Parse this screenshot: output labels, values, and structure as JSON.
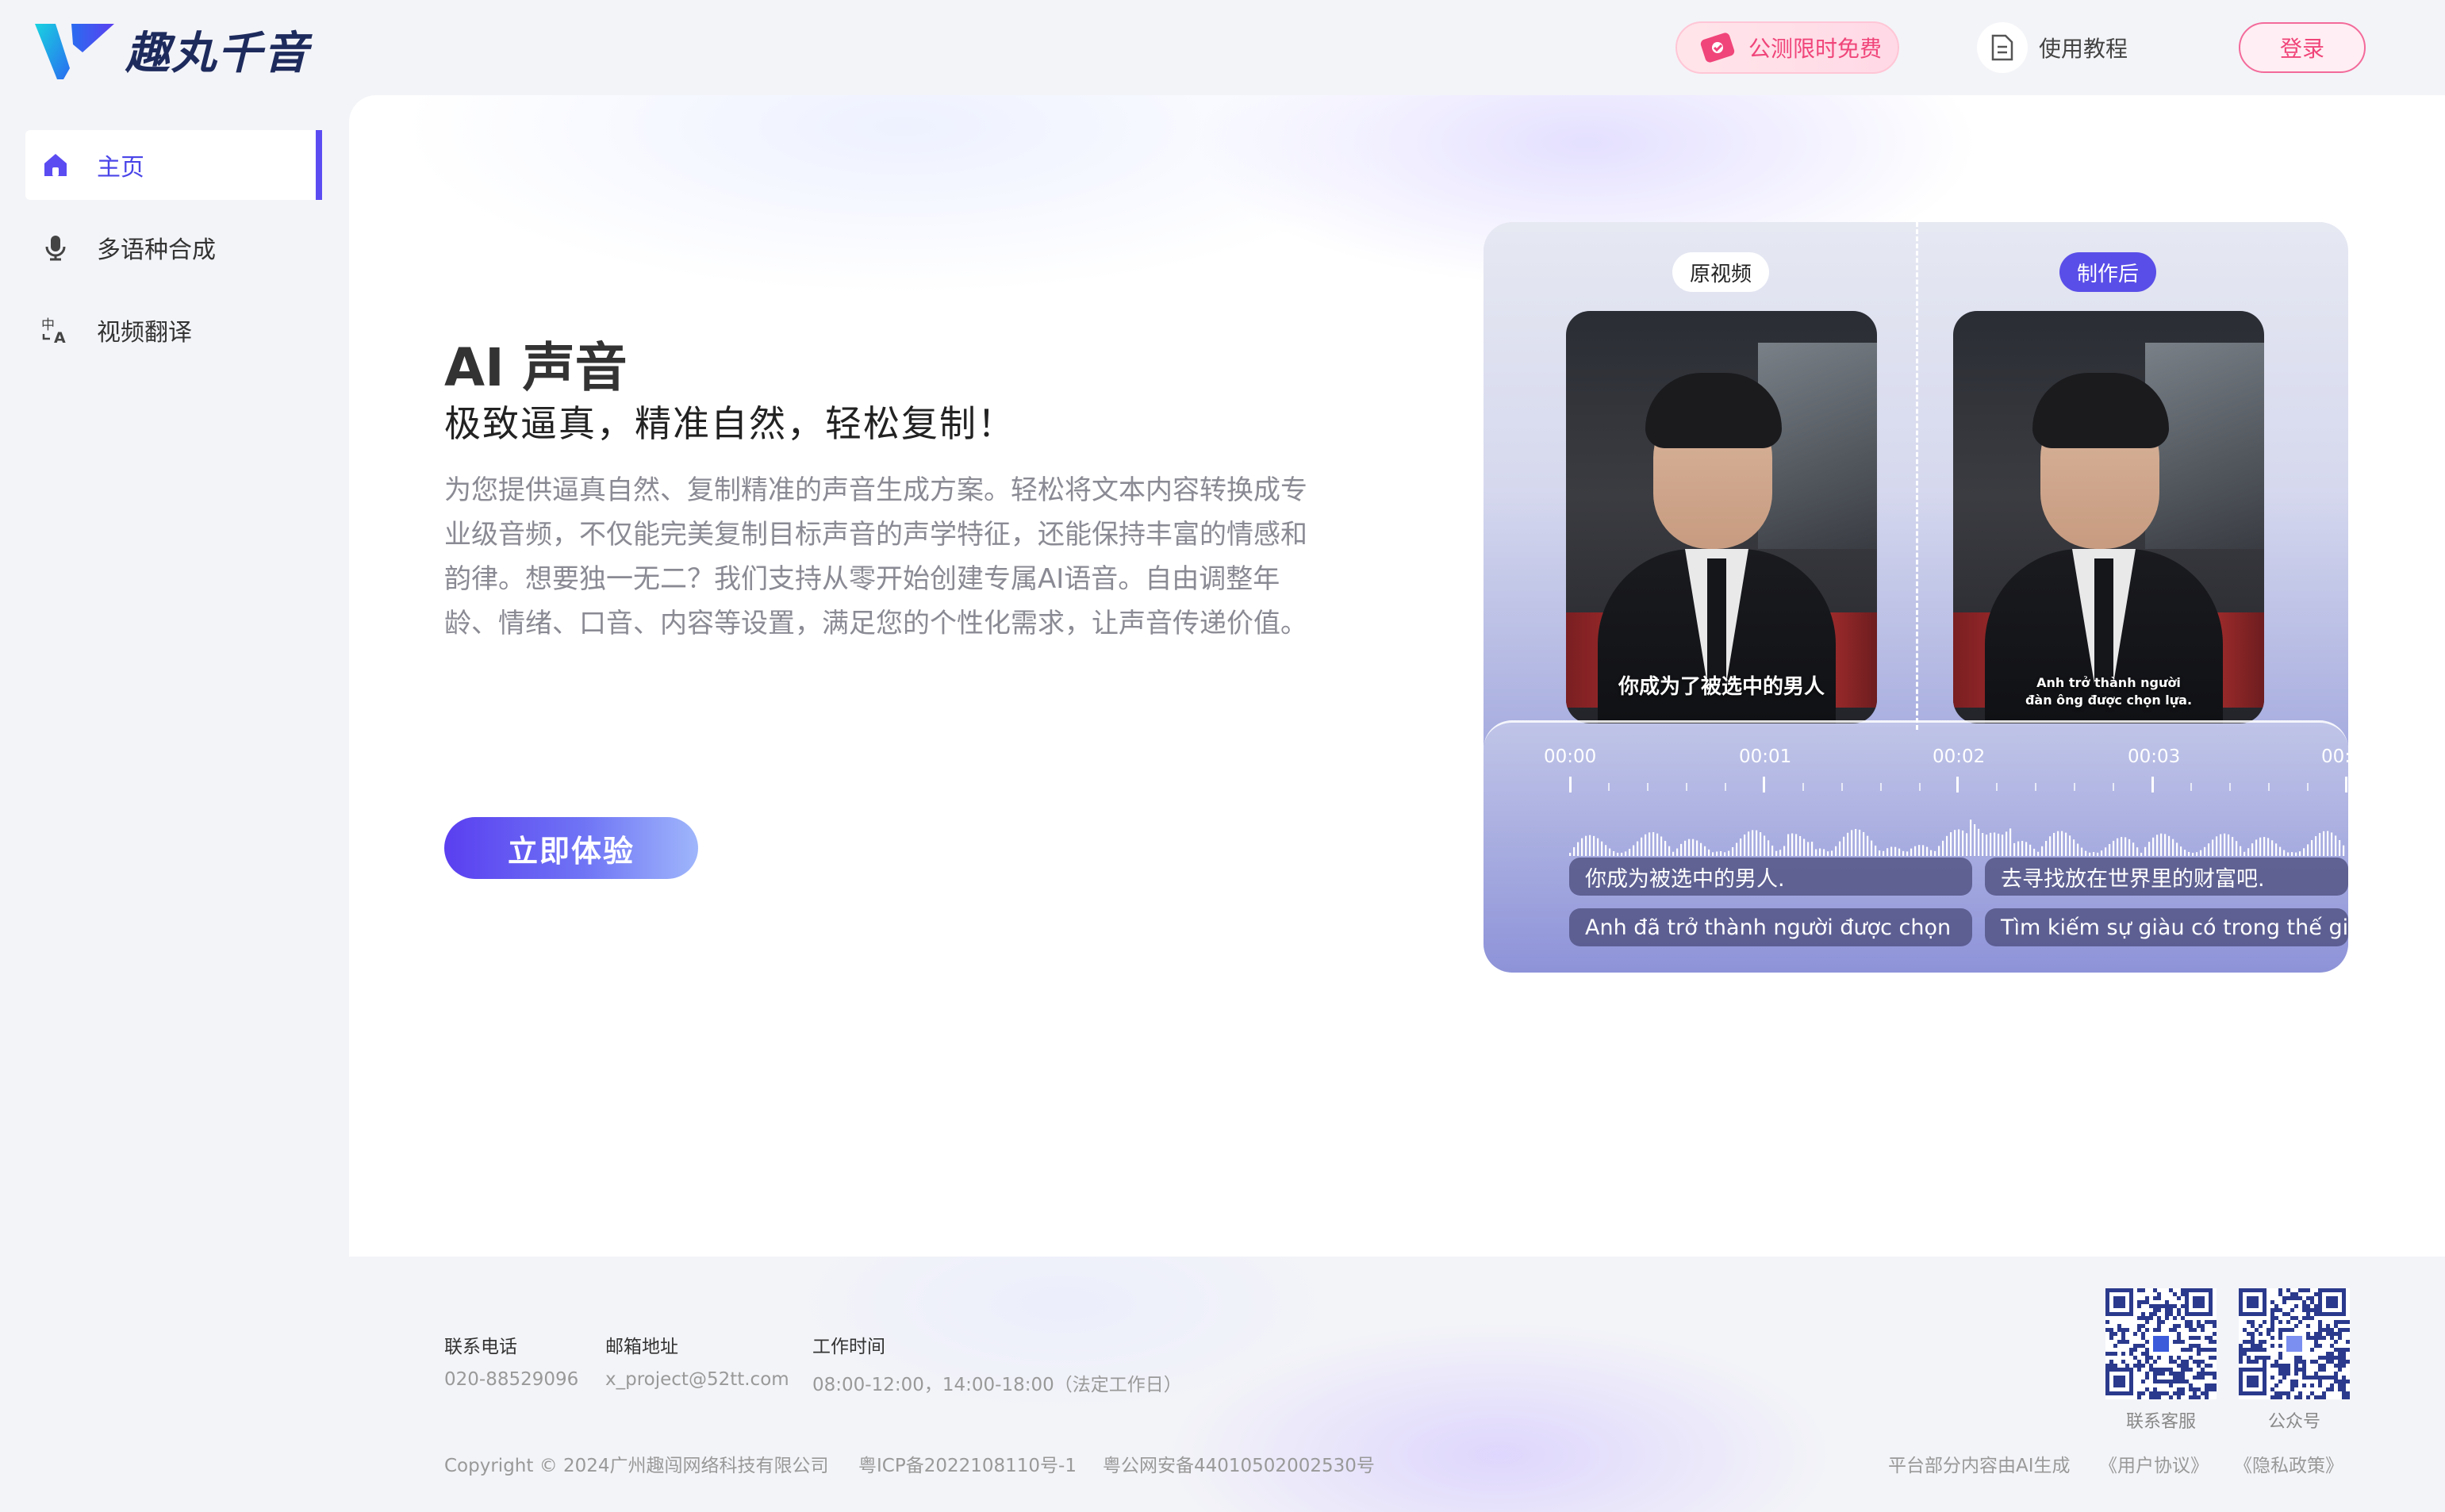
{
  "brand": {
    "name": "趣丸千音",
    "primary": "#5b4cf2",
    "accent_pink": "#f0457a"
  },
  "header": {
    "promo_label": "公测限时免费",
    "tutorial_label": "使用教程",
    "login_label": "登录"
  },
  "sidebar": {
    "items": [
      {
        "label": "主页",
        "icon": "home-icon",
        "active": true
      },
      {
        "label": "多语种合成",
        "icon": "microphone-icon",
        "active": false
      },
      {
        "label": "视频翻译",
        "icon": "translate-icon",
        "active": false
      }
    ]
  },
  "hero": {
    "title": "AI 声音",
    "subtitle": "极致逼真，精准自然，轻松复制！",
    "description": "为您提供逼真自然、复制精准的声音生成方案。轻松将文本内容转换成专业级音频，不仅能完美复制目标声音的声学特征，还能保持丰富的情感和韵律。想要独一无二？我们支持从零开始创建专属AI语音。自由调整年龄、情绪、口音、内容等设置，满足您的个性化需求，让声音传递价值。",
    "cta_label": "立即体验"
  },
  "demo": {
    "original_tag": "原视频",
    "after_tag": "制作后",
    "original_caption": "你成为了被选中的男人",
    "after_caption_line1": "Anh trở thành người",
    "after_caption_line2": "đàn ông được chọn lựa.",
    "timeline_labels": [
      "00:00",
      "00:01",
      "00:02",
      "00:03",
      "00:0"
    ],
    "subtitles_zh": [
      "你成为被选中的男人.",
      "去寻找放在世界里的财富吧."
    ],
    "subtitles_vi": [
      "Anh đã trở thành người được chọn",
      "Tìm kiếm sự giàu có trong thế gi"
    ]
  },
  "footer": {
    "phone_label": "联系电话",
    "phone_value": "020-88529096",
    "email_label": "邮箱地址",
    "email_value": "x_project@52tt.com",
    "hours_label": "工作时间",
    "hours_value": "08:00-12:00，14:00-18:00（法定工作日）",
    "qr_service_label": "联系客服",
    "qr_official_label": "公众号",
    "copyright": "Copyright © 2024广州趣闯网络科技有限公司",
    "icp": "粤ICP备2022108110号-1",
    "police": "粤公网安备44010502002530号",
    "ai_notice": "平台部分内容由AI生成",
    "user_agreement": "《用户协议》",
    "privacy_policy": "《隐私政策》"
  }
}
